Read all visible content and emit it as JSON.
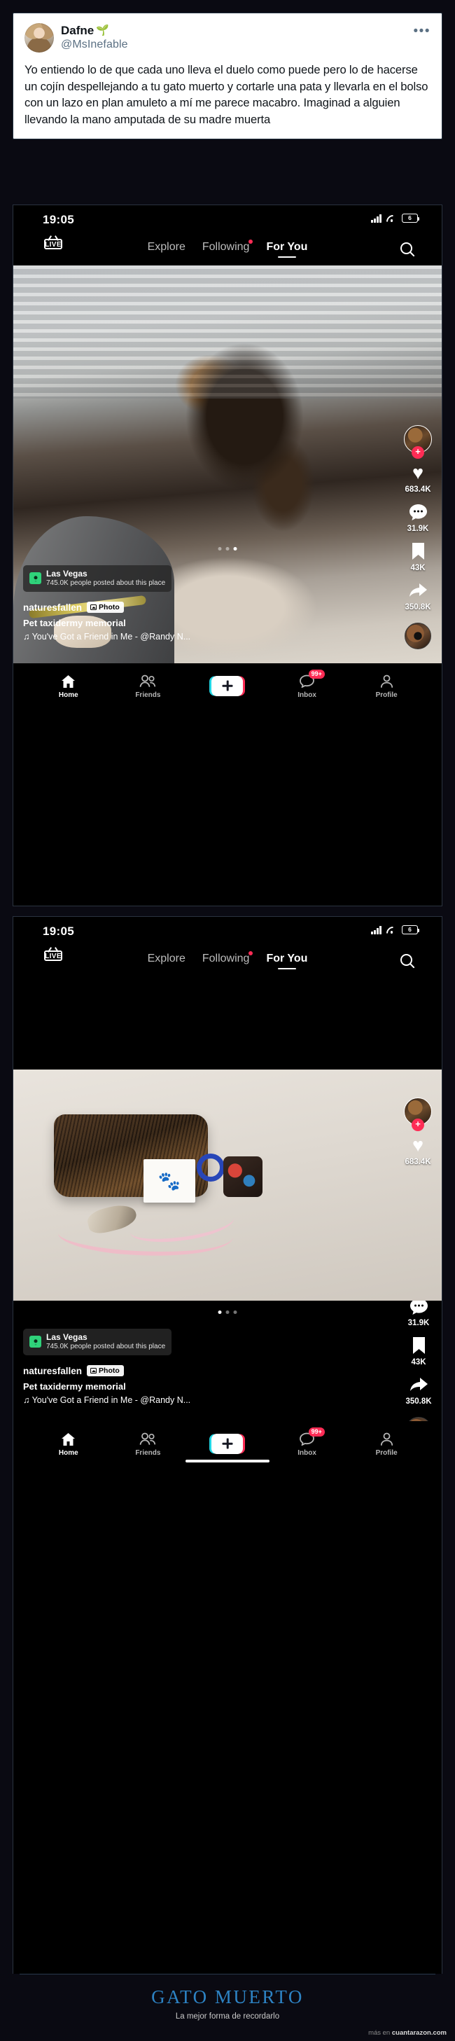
{
  "tweet": {
    "display_name": "Dafne",
    "name_emoji": "🌱",
    "handle": "@MsInefable",
    "more_icon": "•••",
    "text": "Yo entiendo lo de que cada uno lleva el duelo como puede pero lo de hacerse un cojín despellejando a tu gato muerto y cortarle una pata y llevarla en el bolso con un lazo en plan amuleto a mí me parece macabro. Imaginad a alguien llevando la mano amputada de su madre muerta"
  },
  "phone": {
    "status": {
      "time": "19:05",
      "battery": "6"
    },
    "tabs": {
      "live": "LIVE",
      "explore": "Explore",
      "following": "Following",
      "for_you": "For You"
    },
    "location": {
      "name": "Las Vegas",
      "subtitle": "745.0K people posted about this place"
    },
    "caption": {
      "username": "naturesfallen",
      "badge": "Photo",
      "description": "Pet taxidermy memorial",
      "music": "♫ You've Got a Friend in Me - @Randy N..."
    },
    "rail": {
      "like_icon": "♥",
      "likes": "683.4K",
      "comment_icon": "•••",
      "comments": "31.9K",
      "bookmark_icon": "🔖",
      "bookmarks": "43K",
      "share_icon": "➤",
      "shares": "350.8K",
      "follow_plus": "+"
    },
    "bottom_nav": [
      {
        "label": "Home",
        "icon": "⌂"
      },
      {
        "label": "Friends",
        "icon": "👥"
      },
      {
        "label": "",
        "icon": "+"
      },
      {
        "label": "Inbox",
        "icon": "💬",
        "badge": "99+"
      },
      {
        "label": "Profile",
        "icon": "👤"
      }
    ]
  },
  "footer": {
    "title": "GATO MUERTO",
    "subtitle": "La mejor forma de recordarlo",
    "credit_prefix": "más en ",
    "credit_site": "cuantarazon.com"
  },
  "colors": {
    "accent_pink": "#fe2c55",
    "accent_cyan": "#20d5e3",
    "footer_blue": "#2d83c4",
    "location_green": "#2fd27a"
  }
}
